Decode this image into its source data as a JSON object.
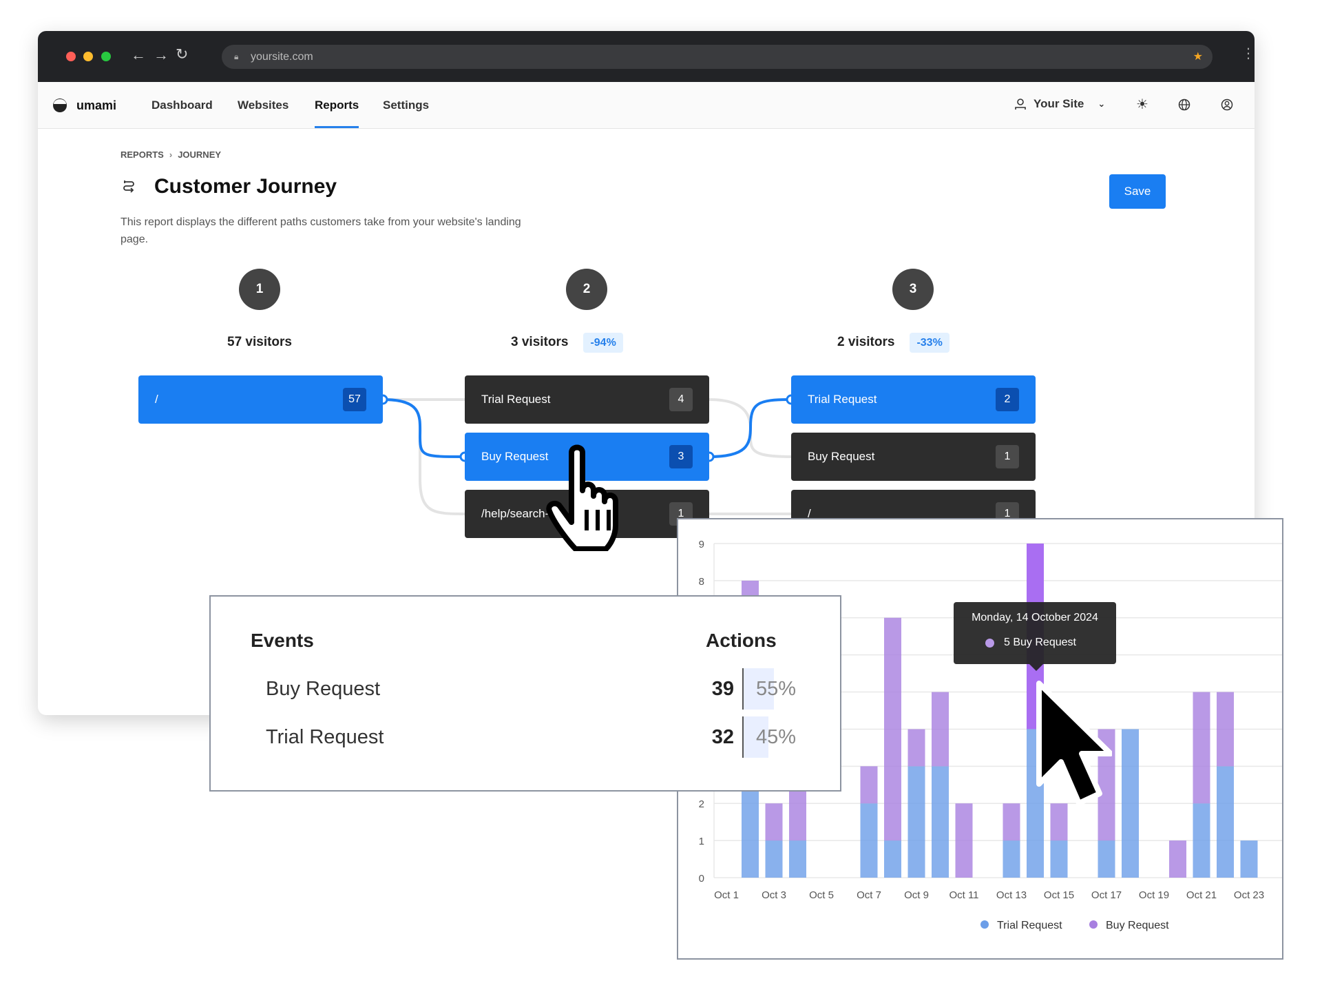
{
  "browser": {
    "url": "yoursite.com",
    "colors": {
      "close": "#ff5f57",
      "minimize": "#febc2e",
      "maximize": "#28c840"
    }
  },
  "nav": {
    "brand": "umami",
    "links": [
      "Dashboard",
      "Websites",
      "Reports",
      "Settings"
    ],
    "active": "Reports",
    "site": "Your Site"
  },
  "breadcrumb": {
    "parent": "REPORTS",
    "current": "JOURNEY"
  },
  "page": {
    "title": "Customer Journey",
    "description": "This report displays the different paths customers take from your website's landing page.",
    "save_label": "Save"
  },
  "journey": {
    "steps": [
      {
        "number": "1",
        "visitors": "57 visitors",
        "change": "",
        "nodes": [
          {
            "label": "/",
            "count": "57",
            "selected": true
          }
        ]
      },
      {
        "number": "2",
        "visitors": "3 visitors",
        "change": "-94%",
        "nodes": [
          {
            "label": "Trial Request",
            "count": "4",
            "selected": false
          },
          {
            "label": "Buy Request",
            "count": "3",
            "selected": true
          },
          {
            "label": "/help/search-2",
            "count": "1",
            "selected": false
          }
        ]
      },
      {
        "number": "3",
        "visitors": "2 visitors",
        "change": "-33%",
        "nodes": [
          {
            "label": "Trial Request",
            "count": "2",
            "selected": true
          },
          {
            "label": "Buy Request",
            "count": "1",
            "selected": false
          },
          {
            "label": "/",
            "count": "1",
            "selected": false
          }
        ]
      }
    ]
  },
  "events": {
    "header_events": "Events",
    "header_actions": "Actions",
    "rows": [
      {
        "name": "Buy Request",
        "count": "39",
        "percent": "55%",
        "share": 0.55
      },
      {
        "name": "Trial Request",
        "count": "32",
        "percent": "45%",
        "share": 0.45
      }
    ]
  },
  "chart_data": {
    "type": "bar",
    "stacked": true,
    "categories": [
      "Oct 1",
      "Oct 2",
      "Oct 3",
      "Oct 4",
      "Oct 5",
      "Oct 6",
      "Oct 7",
      "Oct 8",
      "Oct 9",
      "Oct 10",
      "Oct 11",
      "Oct 12",
      "Oct 13",
      "Oct 14",
      "Oct 15",
      "Oct 16",
      "Oct 17",
      "Oct 18",
      "Oct 19",
      "Oct 20",
      "Oct 21",
      "Oct 22",
      "Oct 23",
      "Oct 24"
    ],
    "tick_labels": [
      "Oct 1",
      "Oct 3",
      "Oct 5",
      "Oct 7",
      "Oct 9",
      "Oct 11",
      "Oct 13",
      "Oct 15",
      "Oct 17",
      "Oct 19",
      "Oct 21",
      "Oct 23"
    ],
    "series": [
      {
        "name": "Trial Request",
        "color": "#6c9ee8",
        "values": [
          0,
          4,
          1,
          1,
          0,
          0,
          2,
          1,
          3,
          3,
          0,
          0,
          1,
          4,
          1,
          0,
          1,
          4,
          0,
          0,
          2,
          3,
          1,
          0
        ]
      },
      {
        "name": "Buy Request",
        "color": "#a77fe0",
        "values": [
          0,
          4,
          1,
          6,
          0,
          0,
          1,
          6,
          1,
          2,
          2,
          0,
          1,
          5,
          1,
          0,
          3,
          0,
          0,
          1,
          3,
          2,
          0,
          0
        ]
      }
    ],
    "ylim": [
      0,
      9
    ],
    "yticks": [
      0,
      1,
      2,
      3,
      4,
      5,
      6,
      7,
      8,
      9
    ],
    "grid": true,
    "legend": "bottom",
    "tooltip": {
      "title": "Monday, 14 October 2024",
      "text": "5 Buy Request",
      "highlight": "Oct 14"
    }
  }
}
